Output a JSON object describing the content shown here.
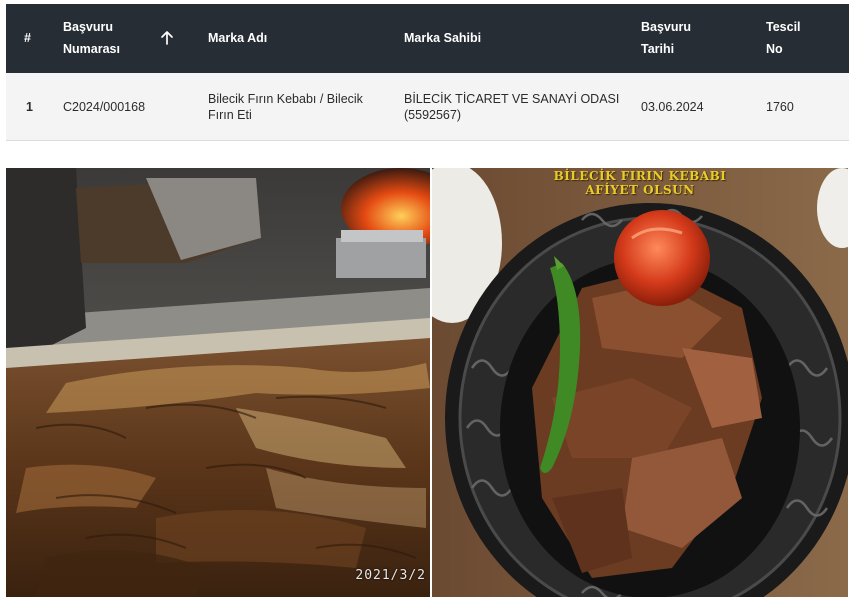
{
  "table": {
    "headers": {
      "number": "#",
      "application_number_line1": "Başvuru",
      "application_number_line2": "Numarası",
      "brand_name": "Marka Adı",
      "brand_owner": "Marka Sahibi",
      "application_date_line1": "Başvuru",
      "application_date_line2": "Tarihi",
      "registration_no_line1": "Tescil",
      "registration_no_line2": "No"
    },
    "rows": [
      {
        "number": "1",
        "application_number": "C2024/000168",
        "brand_name_line1": "Bilecik Fırın Kebabı / Bilecik",
        "brand_name_line2": "Fırın Eti",
        "brand_owner_line1": "BİLECİK TİCARET VE SANAYİ ODASI",
        "brand_owner_line2": "(5592567)",
        "application_date": "03.06.2024",
        "registration_no": "1760"
      }
    ],
    "sort_icon": "arrow-up-icon"
  },
  "photos": {
    "left": {
      "timestamp": "2021/3/2"
    },
    "right": {
      "caption_line1": "BİLECİK FIRIN KEBABI",
      "caption_line2": "AFİYET OLSUN"
    }
  },
  "colors": {
    "header_bg": "#262d35",
    "row_bg": "#f4f4f4",
    "caption_gold": "#e9cc2a"
  }
}
